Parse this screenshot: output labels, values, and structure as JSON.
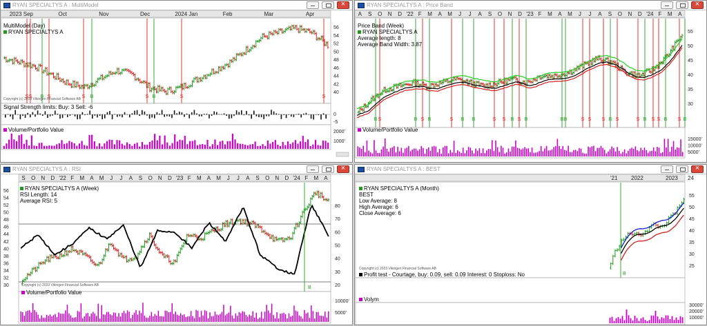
{
  "w1": {
    "title": "RYAN SPECIALTYS A : MultiModel",
    "months": [
      "2023 Sep",
      "Oct",
      "Nov",
      "Dec",
      "2024 Jan",
      "Feb",
      "Mar",
      "Apr"
    ],
    "lines": [
      "MultiModel (Day)",
      "RYAN SPECIALTYS A"
    ],
    "yticks": [
      "56",
      "54",
      "52",
      "50",
      "48",
      "46",
      "44",
      "42",
      "40"
    ],
    "copyright": "Copyright (c) 2023 Vikingen Financial Software AB",
    "sig_label": "Signal Strength limits: Buy: 3  Sell: -6",
    "sig_ticks": [
      "0",
      "-5"
    ],
    "vol_label": "Volume/Portfolio Value",
    "vol_ticks": [
      "2000'",
      "1000'"
    ],
    "sig_letters": [
      "S",
      "S",
      "B",
      "S",
      "S",
      "B",
      "S",
      "B",
      "S",
      "S"
    ]
  },
  "w2": {
    "title": "RYAN SPECIALTYS A : Price Band",
    "months": [
      "A",
      "S",
      "O",
      "N",
      "D",
      "'22",
      "F",
      "M",
      "A",
      "M",
      "J",
      "J",
      "A",
      "S",
      "O",
      "N",
      "D",
      "'23",
      "F",
      "M",
      "A",
      "M",
      "J",
      "J",
      "A",
      "S",
      "O",
      "N",
      "D",
      "'24",
      "F",
      "M",
      "A"
    ],
    "lines": [
      "Price Band (Week)",
      "RYAN SPECIALTYS A",
      "Average length: 8",
      "Average Band Width: 3.87"
    ],
    "yticks": [
      "55",
      "50",
      "45",
      "40",
      "35",
      "30"
    ],
    "vol_label": "Volume/Portfolio Value",
    "vol_ticks": [
      "15000'",
      "10000'",
      "5000'"
    ],
    "sig_letters": [
      "B",
      "S",
      "B",
      "S",
      "B",
      "S",
      "B",
      "B",
      "S",
      "S",
      "B",
      "S",
      "B",
      "B",
      "B",
      "S",
      "S",
      "S",
      "B",
      "S",
      "S",
      "B",
      "S",
      "S",
      "B",
      "S",
      "B"
    ]
  },
  "w3": {
    "title": "RYAN SPECIALTYS A : RSI",
    "months": [
      "S",
      "O",
      "N",
      "D",
      "'22",
      "F",
      "M",
      "A",
      "M",
      "J",
      "J",
      "A",
      "S",
      "O",
      "N",
      "D",
      "'23",
      "F",
      "M",
      "A",
      "M",
      "J",
      "J",
      "A",
      "S",
      "O",
      "N",
      "D",
      "'24",
      "F",
      "M",
      "A"
    ],
    "lines": [
      "RYAN SPECIALTYS A (Week)",
      "RSI Length: 14",
      "Average RSI: 5"
    ],
    "yticks": [
      "56",
      "54",
      "52",
      "50",
      "48",
      "46",
      "44",
      "42",
      "40",
      "38",
      "36",
      "34",
      "32",
      "30"
    ],
    "rsi_ticks": [
      "80",
      "70",
      "60",
      "50",
      "40",
      "30",
      "20"
    ],
    "copyright": "Copyright (c) 2023 Vikingen Financial Software AB",
    "vol_label": "Volume/Portfolio Value",
    "vol_ticks": [
      "10000'",
      "5000'"
    ],
    "sig_letters": [
      "B"
    ]
  },
  "w4": {
    "title": "RYAN SPECIALTYS A : BEST",
    "months": [
      "'21",
      "2022",
      "2023",
      "24"
    ],
    "lines": [
      "RYAN SPECIALTYS A (Month)",
      "BEST",
      "Low Average: 8",
      "High Average: 6",
      "Close Average: 6"
    ],
    "yticks": [
      "55",
      "50",
      "45",
      "40",
      "35",
      "30",
      "25"
    ],
    "copyright": "Copyright (c) 2023 Vikingen Financial Software AB",
    "profit": "Profit test - Courtage, buy: 0.09, sell: 0.09  Interest: 0  Stoploss: No",
    "vol_label": "Volym",
    "vol_ticks": [
      "30000'",
      "20000'",
      "10000'"
    ],
    "sig_letters": [
      "B"
    ]
  },
  "colors": {
    "up": "#1f9a1f",
    "down": "#d4201f",
    "buy": "#22a022",
    "sell": "#e0201a",
    "vol": "#c800c8",
    "avg_blue": "#1020d8",
    "avg_green": "#22d022"
  }
}
